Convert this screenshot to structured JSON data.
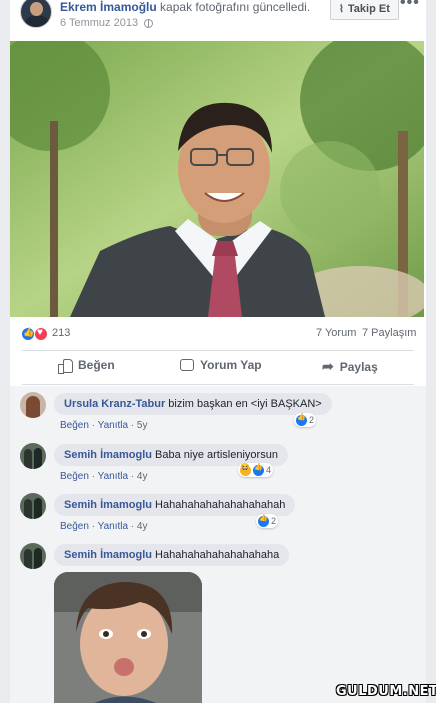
{
  "post": {
    "author": "Ekrem İmamoğlu",
    "action": "kapak fotoğrafını güncelledi.",
    "date": "6 Temmuz 2013",
    "follow_label": "Takip Et",
    "more_label": "•••",
    "follow_icon": "rss-icon",
    "privacy_icon": "globe-icon"
  },
  "stats": {
    "reaction_count": "213",
    "reactions": [
      "like",
      "love"
    ],
    "comments": "7 Yorum",
    "shares": "7 Paylaşım"
  },
  "actions": {
    "like": "Beğen",
    "comment": "Yorum Yap",
    "share": "Paylaş"
  },
  "comments": [
    {
      "name": "Ursula Kranz-Tabur",
      "text": "bizim başkan en <iyi BAŞKAN>",
      "like": "Beğen",
      "reply": "Yanıtla",
      "time": "5y",
      "reaction_count": "2"
    },
    {
      "name": "Semih İmamoglu",
      "text": "Baba niye artisleniyorsun",
      "like": "Beğen",
      "reply": "Yanıtla",
      "time": "4y",
      "reaction_count": "4"
    },
    {
      "name": "Semih İmamoglu",
      "text": "Hahahahahahahahahahah",
      "like": "Beğen",
      "reply": "Yanıtla",
      "time": "4y",
      "reaction_count": "2"
    },
    {
      "name": "Semih İmamoglu",
      "text": "Hahahahahahahahahaha"
    }
  ],
  "watermark": "GULDUM.NET",
  "colors": {
    "link": "#365899",
    "like_blue": "#1877f2",
    "love_red": "#f33e58",
    "bubble": "#e4e6eb"
  }
}
